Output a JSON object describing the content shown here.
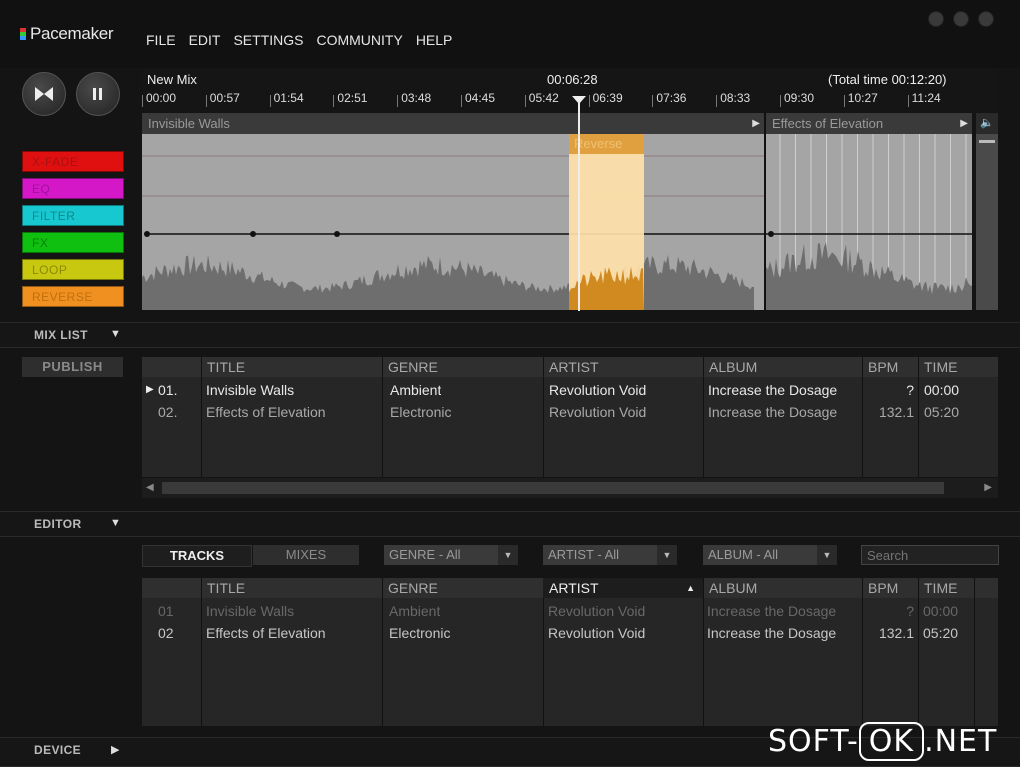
{
  "app": {
    "logo": "Pacemaker"
  },
  "menu": [
    "FILE",
    "EDIT",
    "SETTINGS",
    "COMMUNITY",
    "HELP"
  ],
  "effects": [
    {
      "label": "X-FADE",
      "color": "#e01010",
      "text": "#a81010"
    },
    {
      "label": "EQ",
      "color": "#d418c8",
      "text": "#a010a0"
    },
    {
      "label": "FILTER",
      "color": "#18c8d0",
      "text": "#108890"
    },
    {
      "label": "FX",
      "color": "#10c010",
      "text": "#0a800a"
    },
    {
      "label": "LOOP",
      "color": "#c8c810",
      "text": "#8a8a08"
    },
    {
      "label": "REVERSE",
      "color": "#f09020",
      "text": "#c07010"
    }
  ],
  "timeline": {
    "mix_name": "New Mix",
    "position": "00:06:28",
    "total": "(Total time 00:12:20)",
    "ticks": [
      "00:00",
      "00:57",
      "01:54",
      "02:51",
      "03:48",
      "04:45",
      "05:42",
      "06:39",
      "07:36",
      "08:33",
      "09:30",
      "10:27",
      "11:24"
    ]
  },
  "tracks_in_timeline": [
    "Invisible Walls",
    "Effects of Elevation"
  ],
  "reverse_label": "Reverse",
  "mixlist": {
    "header": "MIX LIST",
    "publish": "PUBLISH",
    "columns": [
      "TITLE",
      "GENRE",
      "ARTIST",
      "ALBUM",
      "BPM",
      "TIME"
    ],
    "rows": [
      {
        "num": "01.",
        "title": "Invisible Walls",
        "genre": "Ambient",
        "artist": "Revolution Void",
        "album": "Increase the Dosage",
        "bpm": "?",
        "time": "00:00"
      },
      {
        "num": "02.",
        "title": "Effects of Elevation",
        "genre": "Electronic",
        "artist": "Revolution Void",
        "album": "Increase the Dosage",
        "bpm": "132.1",
        "time": "05:20"
      }
    ]
  },
  "editor": {
    "header": "EDITOR",
    "tabs": [
      "TRACKS",
      "MIXES"
    ],
    "filters": [
      "GENRE - All",
      "ARTIST - All",
      "ALBUM - All"
    ],
    "search_placeholder": "Search",
    "columns": [
      "TITLE",
      "GENRE",
      "ARTIST",
      "ALBUM",
      "BPM",
      "TIME"
    ],
    "rows": [
      {
        "num": "01",
        "title": "Invisible Walls",
        "genre": "Ambient",
        "artist": "Revolution Void",
        "album": "Increase the Dosage",
        "bpm": "?",
        "time": "00:00"
      },
      {
        "num": "02",
        "title": "Effects of Elevation",
        "genre": "Electronic",
        "artist": "Revolution Void",
        "album": "Increase the Dosage",
        "bpm": "132.1",
        "time": "05:20"
      }
    ]
  },
  "device": {
    "header": "DEVICE"
  },
  "watermark": {
    "pre": "SOFT-",
    "ok": "OK",
    "post": ".NET"
  }
}
